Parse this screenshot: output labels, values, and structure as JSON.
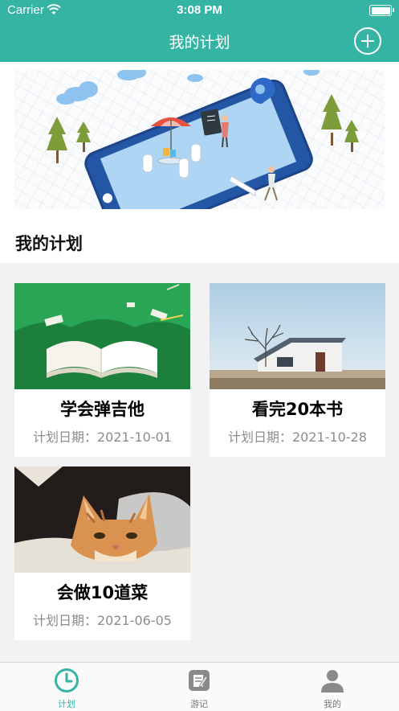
{
  "status_bar": {
    "carrier": "Carrier",
    "time": "3:08 PM"
  },
  "nav": {
    "title": "我的计划",
    "add_icon": "plus-circle-icon"
  },
  "section": {
    "title": "我的计划"
  },
  "plans": [
    {
      "title": "学会弹吉他",
      "date": "计划日期：2021-10-01",
      "image": "open-book-image"
    },
    {
      "title": "看完20本书",
      "date": "计划日期：2021-10-28",
      "image": "house-tree-image"
    },
    {
      "title": "会做10道菜",
      "date": "计划日期：2021-06-05",
      "image": "cat-image"
    }
  ],
  "tabs": [
    {
      "label": "计划",
      "icon": "clock-icon",
      "active": true
    },
    {
      "label": "游记",
      "icon": "note-edit-icon",
      "active": false
    },
    {
      "label": "我的",
      "icon": "user-icon",
      "active": false
    }
  ],
  "colors": {
    "primary": "#35b4a3",
    "background": "#f2f2f5",
    "date_text": "#8c8c8c"
  }
}
